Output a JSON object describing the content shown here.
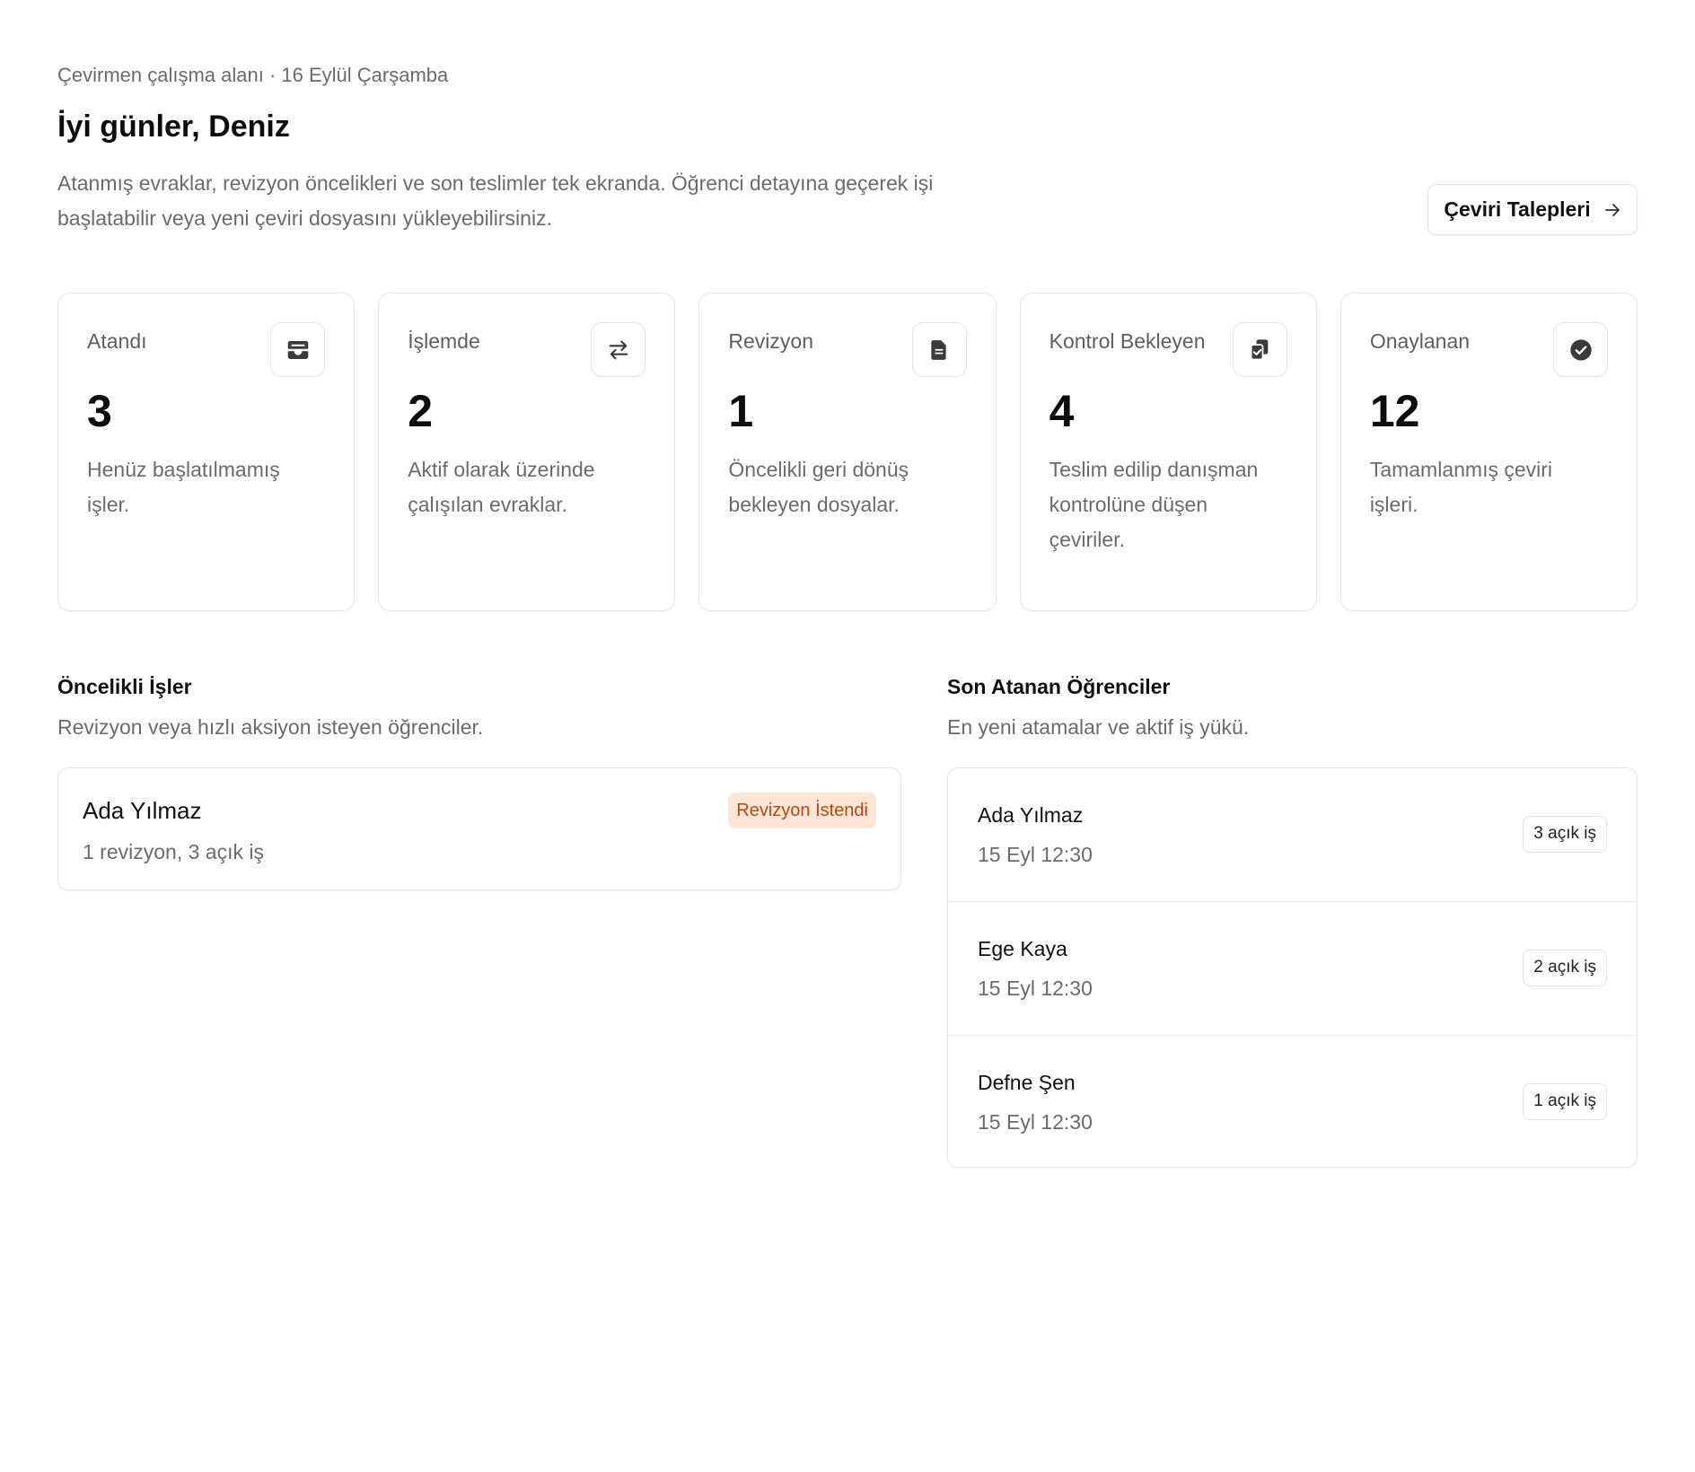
{
  "header": {
    "eyebrow": "Çevirmen çalışma alanı · 16 Eylül Çarşamba",
    "greeting": "İyi günler, Deniz",
    "intro": "Atanmış evraklar, revizyon öncelikleri ve son teslimler tek ekranda. Öğrenci detayına geçerek işi başlatabilir veya yeni çeviri dosyasını yükleyebilirsiniz.",
    "cta_label": "Çeviri Talepleri",
    "cta_icon": "arrow-right-icon"
  },
  "stats": [
    {
      "label": "Atandı",
      "value": "3",
      "desc": "Henüz başlatılmamış işler.",
      "icon": "inbox-icon"
    },
    {
      "label": "İşlemde",
      "value": "2",
      "desc": "Aktif olarak üzerinde çalışılan evraklar.",
      "icon": "swap-arrows-icon"
    },
    {
      "label": "Revizyon",
      "value": "1",
      "desc": "Öncelikli geri dönüş bekleyen dosyalar.",
      "icon": "document-icon"
    },
    {
      "label": "Kontrol Bekleyen",
      "value": "4",
      "desc": "Teslim edilip danışman kontrolüne düşen çeviriler.",
      "icon": "clipboard-check-icon"
    },
    {
      "label": "Onaylanan",
      "value": "12",
      "desc": "Tamamlanmış çeviri işleri.",
      "icon": "check-circle-icon"
    }
  ],
  "priority": {
    "title": "Öncelikli İşler",
    "subtitle": "Revizyon veya hızlı aksiyon isteyen öğrenciler.",
    "items": [
      {
        "name": "Ada Yılmaz",
        "meta": "1 revizyon, 3 açık iş",
        "badge": "Revizyon İstendi"
      }
    ]
  },
  "recent": {
    "title": "Son Atanan Öğrenciler",
    "subtitle": "En yeni atamalar ve aktif iş yükü.",
    "items": [
      {
        "name": "Ada Yılmaz",
        "date": "15 Eyl 12:30",
        "open": "3 açık iş"
      },
      {
        "name": "Ege Kaya",
        "date": "15 Eyl 12:30",
        "open": "2 açık iş"
      },
      {
        "name": "Defne Şen",
        "date": "15 Eyl 12:30",
        "open": "1 açık iş"
      }
    ]
  },
  "colors": {
    "badge_bg": "#fde6d6",
    "badge_text": "#b54a12",
    "muted_text": "#6b6b6b",
    "border": "#e5e5e5"
  }
}
